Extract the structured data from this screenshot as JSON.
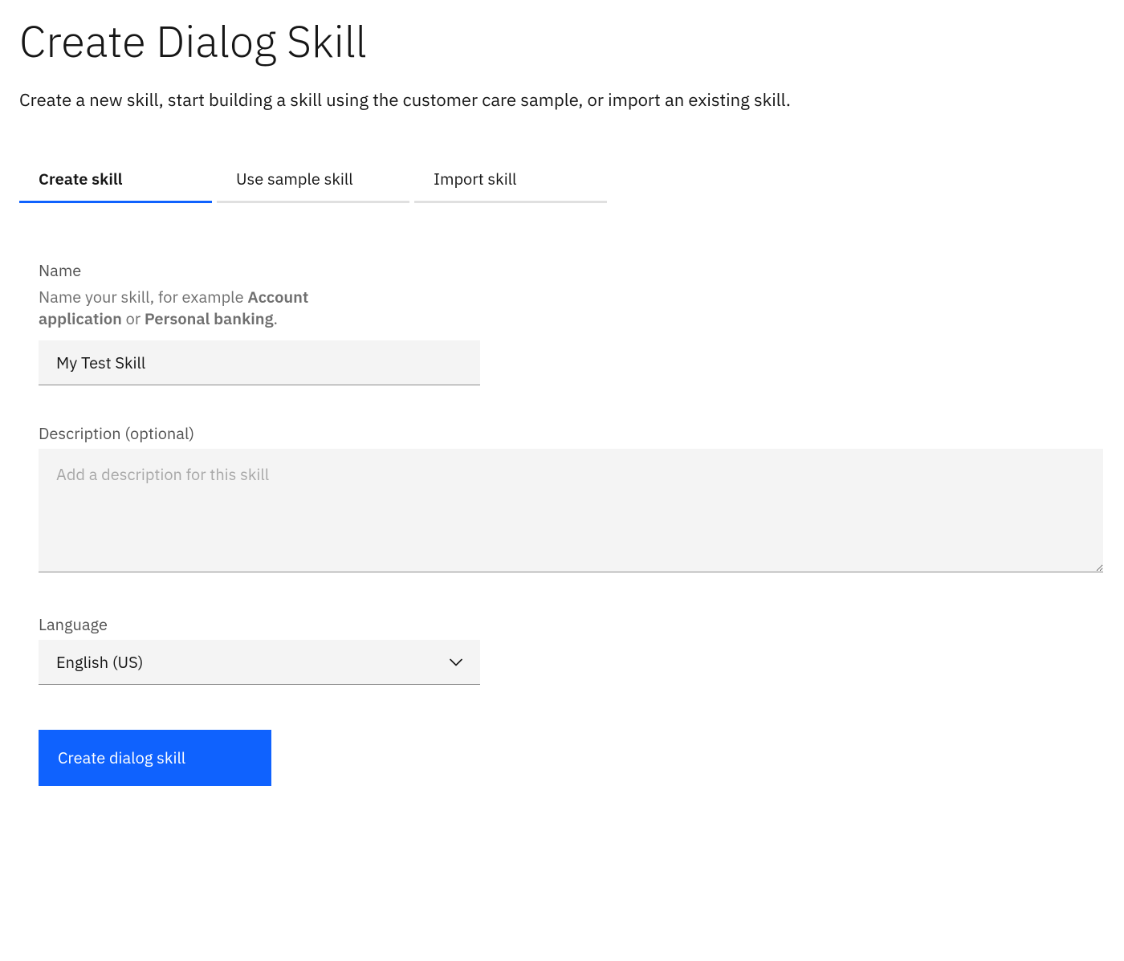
{
  "header": {
    "title": "Create Dialog Skill",
    "subtitle": "Create a new skill, start building a skill using the customer care sample, or import an existing skill."
  },
  "tabs": [
    {
      "id": "create",
      "label": "Create skill",
      "active": true
    },
    {
      "id": "sample",
      "label": "Use sample skill",
      "active": false
    },
    {
      "id": "import",
      "label": "Import skill",
      "active": false
    }
  ],
  "form": {
    "name": {
      "label": "Name",
      "helper_prefix": "Name your skill, for example ",
      "helper_example1": "Account application",
      "helper_mid": " or ",
      "helper_example2": "Personal banking",
      "helper_suffix": ".",
      "value": "My Test Skill"
    },
    "description": {
      "label": "Description (optional)",
      "placeholder": "Add a description for this skill",
      "value": ""
    },
    "language": {
      "label": "Language",
      "selected": "English (US)"
    }
  },
  "actions": {
    "create_label": "Create dialog skill"
  }
}
